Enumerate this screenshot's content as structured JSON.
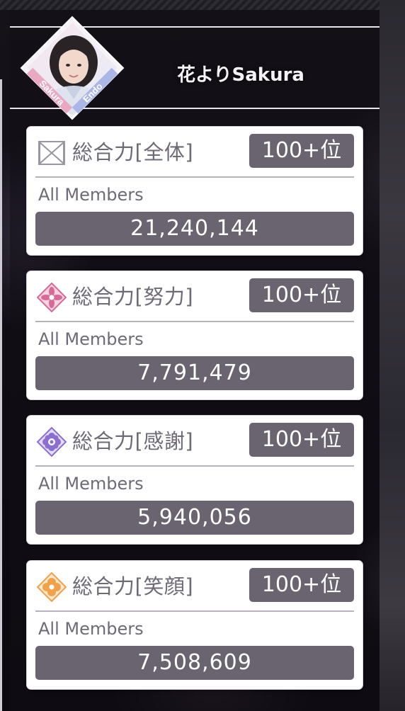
{
  "header": {
    "title": "花よりSakura",
    "badge": {
      "text_left": "Sakura",
      "text_right": "Endo",
      "accent_left": "#e9a9c0",
      "accent_right": "#a9b6e6"
    }
  },
  "cards": [
    {
      "icon": "overall-icon",
      "label": "総合力[全体]",
      "rank": "100+位",
      "subtitle": "All Members",
      "value": "21,240,144"
    },
    {
      "icon": "effort-icon",
      "label": "総合力[努力]",
      "rank": "100+位",
      "subtitle": "All Members",
      "value": "7,791,479"
    },
    {
      "icon": "gratitude-icon",
      "label": "総合力[感謝]",
      "rank": "100+位",
      "subtitle": "All Members",
      "value": "5,940,056"
    },
    {
      "icon": "smile-icon",
      "label": "総合力[笑顔]",
      "rank": "100+位",
      "subtitle": "All Members",
      "value": "7,508,609"
    }
  ],
  "colors": {
    "card_bg": "#ffffff",
    "pill_bg": "#6a6470",
    "label_text": "#6e6a76",
    "effort": "#d76b98",
    "gratitude": "#8a6fd0",
    "smile": "#f0a24a"
  }
}
